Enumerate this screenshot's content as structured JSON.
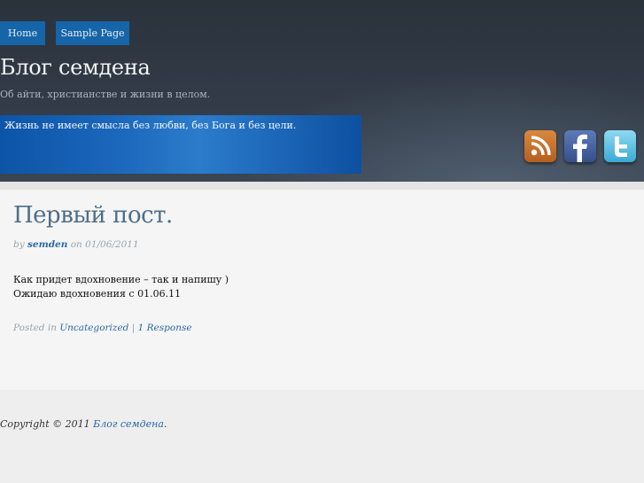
{
  "nav": {
    "home": "Home",
    "sample_page": "Sample Page"
  },
  "site": {
    "title": "Блог семдена",
    "description": "Об айти, христианстве и жизни в целом."
  },
  "quote": "Жизнь не имеет смысла без любви, без Бога и без цели.",
  "social": {
    "icons": [
      "rss-icon",
      "facebook-icon",
      "twitter-icon"
    ]
  },
  "post": {
    "title": "Первый пост.",
    "meta_by": "by",
    "author": "semden",
    "meta_on": "on",
    "date": "01/06/2011",
    "body_line1": "Как придет вдохновение – так и напишу )",
    "body_line2": "Ожидаю вдохновения с 01.06.11",
    "posted_in_label": "Posted in",
    "category": "Uncategorized",
    "separator": "|",
    "responses": "1 Response"
  },
  "footer": {
    "copyright": "Copyright © 2011",
    "site_link": "Блог семдена",
    "period": "."
  },
  "colors": {
    "nav_button": "#1565a8",
    "header_bg": "#2e3742",
    "quote_box": "#1d69bd",
    "post_title": "#4e6e88",
    "link": "#2d6aa5"
  }
}
